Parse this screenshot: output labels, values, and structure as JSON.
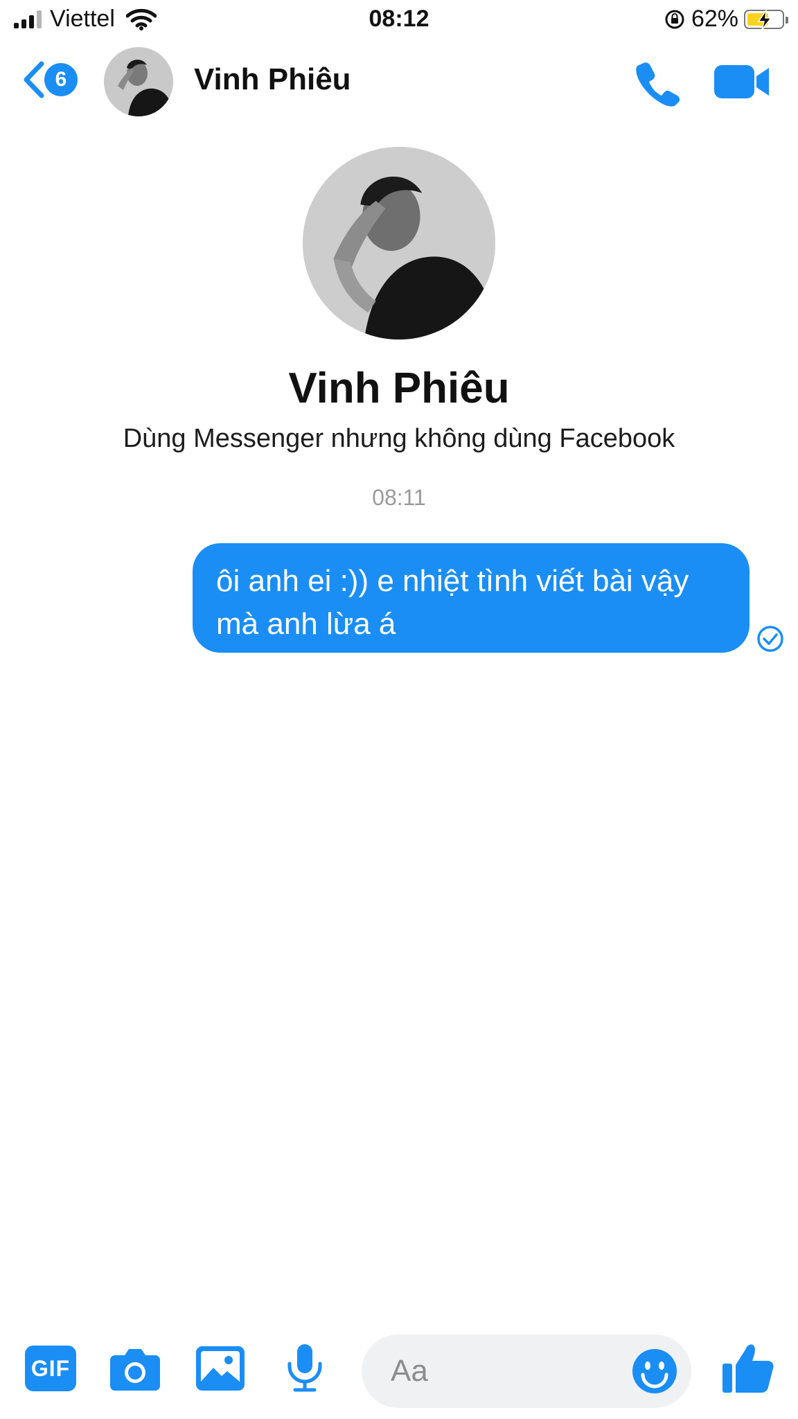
{
  "status_bar": {
    "carrier": "Viettel",
    "time": "08:12",
    "battery_percent": "62%",
    "battery_level": 0.62
  },
  "header": {
    "back_badge": "6",
    "contact_name": "Vinh Phiêu",
    "icons": [
      "back-chevron-icon",
      "phone-icon",
      "video-camera-icon"
    ]
  },
  "profile": {
    "name": "Vinh Phiêu",
    "subtitle": "Dùng Messenger nhưng không dùng Facebook"
  },
  "conversation": {
    "timestamp": "08:11",
    "messages": [
      {
        "sender": "me",
        "text": "ôi anh ei :)) e nhiệt tình viết bài vậy mà anh lừa á",
        "status_icon": "read-check-icon"
      }
    ]
  },
  "composer": {
    "gif_label": "GIF",
    "placeholder": "Aa",
    "icons": [
      "camera-icon",
      "image-icon",
      "microphone-icon",
      "emoji-icon",
      "thumbs-up-icon"
    ]
  },
  "colors": {
    "accent": "#1a8ef5",
    "input_bg": "#f0f1f3",
    "timestamp_gray": "#9a9a9a"
  }
}
